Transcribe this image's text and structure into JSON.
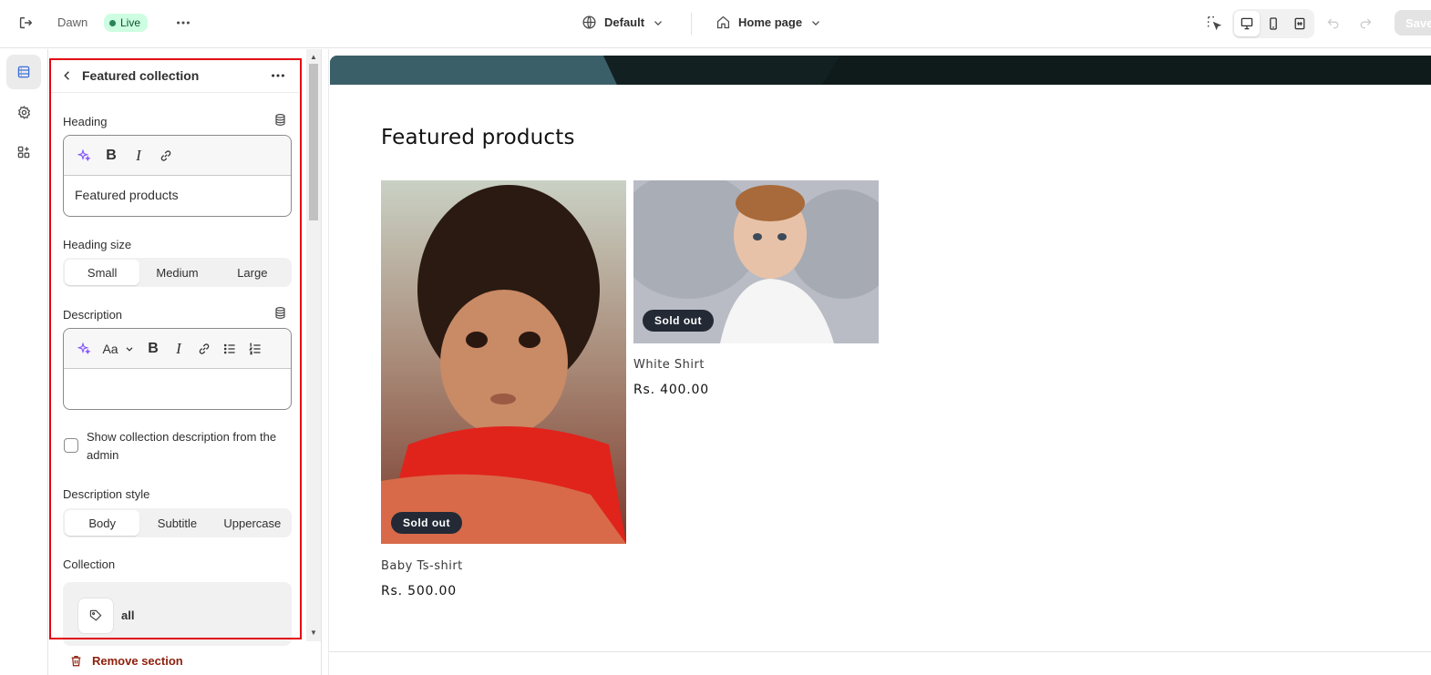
{
  "topbar": {
    "theme_name": "Dawn",
    "live_label": "Live",
    "template_selector": "Default",
    "page_selector": "Home page",
    "save_label": "Save"
  },
  "panel": {
    "title": "Featured collection",
    "heading_label": "Heading",
    "heading_value": "Featured products",
    "heading_size_label": "Heading size",
    "heading_size_options": [
      "Small",
      "Medium",
      "Large"
    ],
    "heading_size_selected": "Small",
    "description_label": "Description",
    "description_value": "",
    "description_font_tool": "Aa",
    "show_description_label": "Show collection description from the admin",
    "show_description_checked": false,
    "description_style_label": "Description style",
    "description_style_options": [
      "Body",
      "Subtitle",
      "Uppercase"
    ],
    "description_style_selected": "Body",
    "collection_label": "Collection",
    "collection_name": "all",
    "remove_section_label": "Remove section"
  },
  "preview": {
    "section_title": "Featured products",
    "products": [
      {
        "name": "Baby Ts-shirt",
        "price": "Rs. 500.00",
        "badge": "Sold out"
      },
      {
        "name": "White Shirt",
        "price": "Rs. 400.00",
        "badge": "Sold out"
      }
    ]
  },
  "colors": {
    "highlight_border": "#e30613",
    "live_badge_bg": "#cdfee1",
    "sold_out_badge": "#232a36",
    "remove_red": "#8e1f0b",
    "ai_sparkle": "#8051ff"
  }
}
